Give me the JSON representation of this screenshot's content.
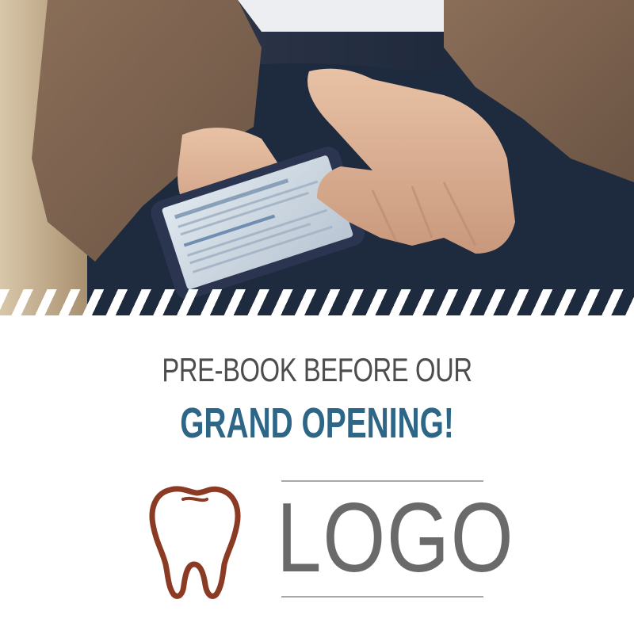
{
  "headline": {
    "line1": "PRE-BOOK BEFORE OUR",
    "line2": "GRAND OPENING!"
  },
  "logo": {
    "text": "LOGO",
    "icon": "tooth-icon"
  },
  "photo": {
    "subject": "hands-holding-smartphone"
  },
  "colors": {
    "headline_dark": "#4d4d4d",
    "headline_accent": "#2d6687",
    "logo_text": "#6a6a6a",
    "tooth": "#8b3a23",
    "rule": "#a8a8a8",
    "stripe": "#ffffff"
  }
}
